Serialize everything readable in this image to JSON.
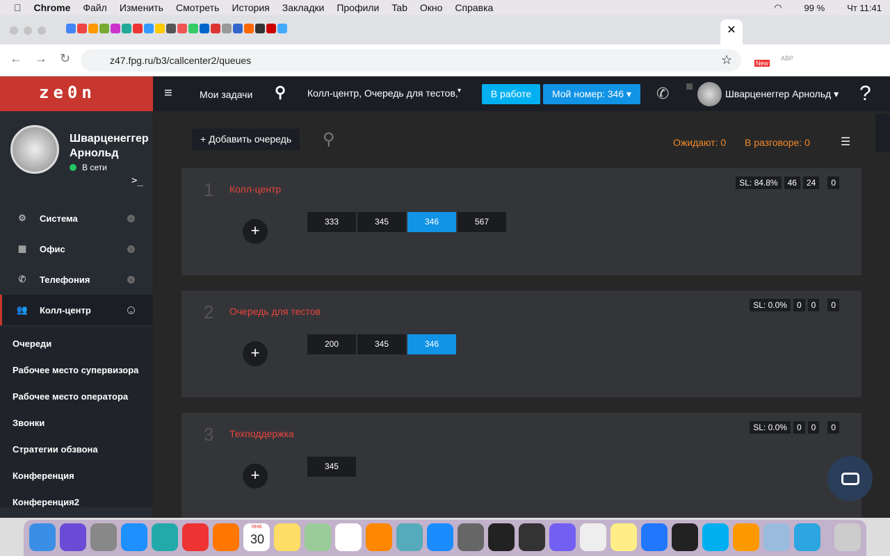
{
  "menubar": {
    "apple": "",
    "items": [
      "Chrome",
      "Файл",
      "Изменить",
      "Смотреть",
      "История",
      "Закладки",
      "Профили",
      "Tab",
      "Окно",
      "Справка"
    ],
    "battery": "99 %",
    "clock": "Чт 11:41"
  },
  "browser": {
    "url": "z47.fpg.ru/b3/callcenter2/queues",
    "new_badge": "New",
    "abp": "ABP"
  },
  "app": {
    "logo": "ze0n",
    "header": {
      "my_tasks": "Мои задачи",
      "context": "Колл-центр, Очередь для тестов,",
      "status_button": "В работе",
      "my_number": "Мой номер: 346",
      "user": "Шварценеггер Арнольд",
      "help": "?"
    },
    "profile": {
      "name_line1": "Шварценеггер",
      "name_line2": "Арнольд",
      "status": "В сети",
      "status_color": "#22c55e",
      "console": ">_"
    },
    "sidebar": {
      "items": [
        {
          "label": "Система",
          "icon": "gear-icon"
        },
        {
          "label": "Офис",
          "icon": "office-icon"
        },
        {
          "label": "Телефония",
          "icon": "phone-icon"
        },
        {
          "label": "Колл-центр",
          "icon": "users-icon"
        }
      ],
      "submenu": [
        "Очереди",
        "Рабочее место супервизора",
        "Рабочее место оператора",
        "Звонки",
        "Стратегии обзвона",
        "Конференция",
        "Конференция2"
      ]
    },
    "toolbar": {
      "add_queue": "+ Добавить очередь",
      "waiting": "Ожидают: 0",
      "talking": "В разговоре: 0"
    },
    "queues": [
      {
        "num": "1",
        "name": "Колл-центр",
        "sl": "SL: 84.8%",
        "stats": [
          "46",
          "24",
          "0"
        ],
        "agents": [
          "333",
          "345",
          "346",
          "567"
        ],
        "highlight": "346"
      },
      {
        "num": "2",
        "name": "Очередь для тестов",
        "sl": "SL: 0.0%",
        "stats": [
          "0",
          "0",
          "0"
        ],
        "agents": [
          "200",
          "345",
          "346"
        ],
        "highlight": "346"
      },
      {
        "num": "3",
        "name": "Техподдержка",
        "sl": "SL: 0.0%",
        "stats": [
          "0",
          "0",
          "0"
        ],
        "agents": [
          "345"
        ],
        "highlight": ""
      }
    ],
    "colors": {
      "accent": "#c7372f",
      "primary": "#1193e6",
      "status_btn": "#00b0f0",
      "orange": "#f0892a",
      "queue_title": "#e8453c"
    }
  },
  "dock": {
    "calendar_day": "30",
    "calendar_month": "ЯНВ."
  }
}
